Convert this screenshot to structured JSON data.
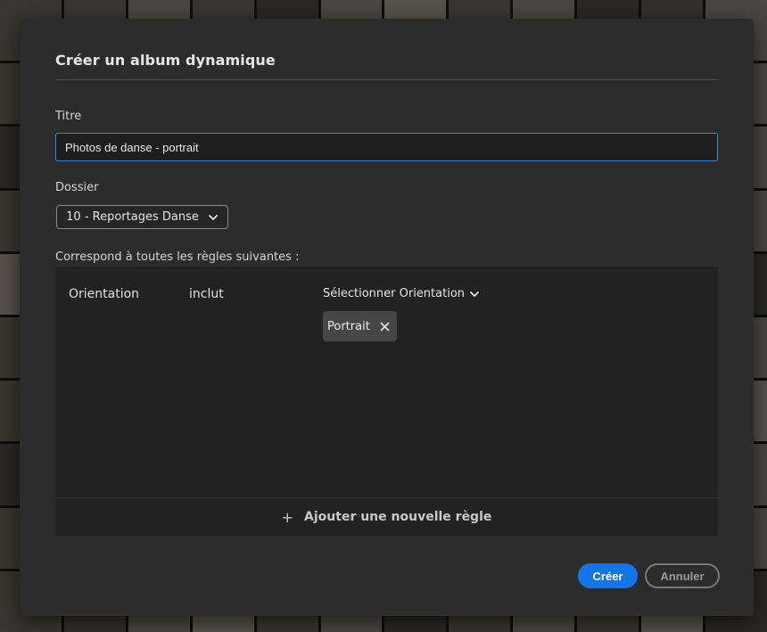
{
  "dialog": {
    "title": "Créer un album dynamique"
  },
  "title_field": {
    "label": "Titre",
    "value": "Photos de danse - portrait"
  },
  "folder_field": {
    "label": "Dossier",
    "selected": "10 - Reportages Danse"
  },
  "rules": {
    "label": "Correspond à toutes les règles suivantes :",
    "items": [
      {
        "field": "Orientation",
        "operator": "inclut",
        "value_select_label": "Sélectionner Orientation",
        "tags": [
          "Portrait"
        ]
      }
    ],
    "add_rule_label": "Ajouter une nouvelle règle"
  },
  "buttons": {
    "create": "Créer",
    "cancel": "Annuler"
  },
  "colors": {
    "accent": "#1473e6",
    "dialog_bg": "#2c2c2c",
    "panel_bg": "#222222",
    "input_focus_border": "#3d7fe0"
  },
  "icons": {
    "folder_dropdown": "chevron-down-icon",
    "value_dropdown": "chevron-down-icon",
    "tag_remove": "close-icon",
    "add_rule": "plus-icon"
  }
}
